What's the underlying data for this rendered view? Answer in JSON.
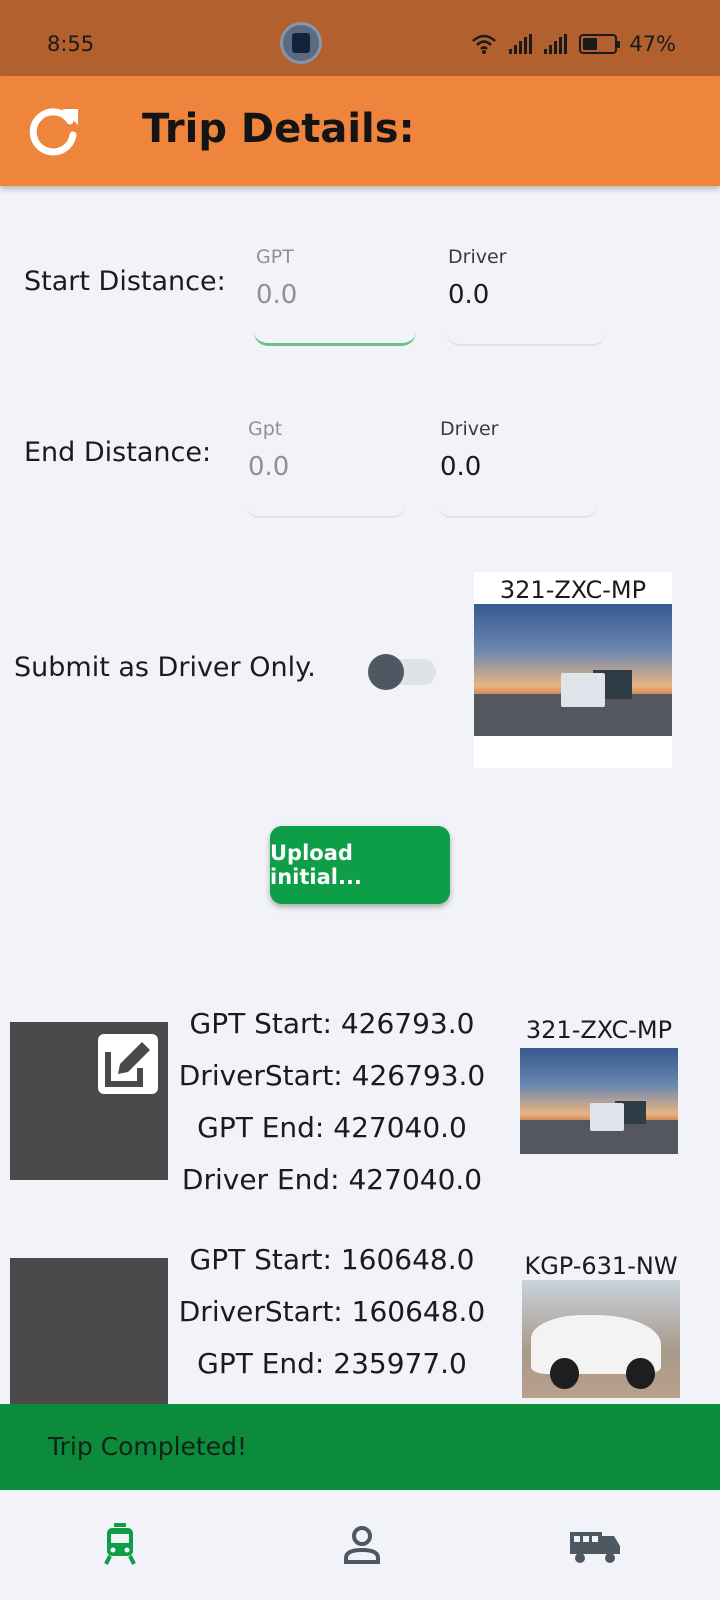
{
  "status_bar": {
    "time": "8:55",
    "battery": "47%",
    "battery_level": 0.47
  },
  "app_bar": {
    "title": "Trip Details:",
    "refresh_icon": "refresh-icon"
  },
  "start_distance": {
    "label": "Start Distance:",
    "gpt": {
      "label": "GPT",
      "value": "0.0"
    },
    "driver": {
      "label": "Driver",
      "value": "0.0"
    }
  },
  "end_distance": {
    "label": "End Distance:",
    "gpt": {
      "label": "Gpt",
      "value": "0.0"
    },
    "driver": {
      "label": "Driver",
      "value": "0.0"
    }
  },
  "driver_only": {
    "label": "Submit as Driver Only.",
    "enabled": false
  },
  "vehicle": {
    "plate": "321-ZXC-MP"
  },
  "upload_button": {
    "label": "Upload initial..."
  },
  "trips": [
    {
      "lines": [
        "GPT Start: 426793.0",
        "DriverStart: 426793.0",
        "GPT End: 427040.0",
        "Driver End: 427040.0"
      ],
      "plate": "321-ZXC-MP",
      "image": "truck-photo",
      "edit_icon": "edit-icon"
    },
    {
      "lines": [
        "GPT Start: 160648.0",
        "DriverStart: 160648.0",
        "GPT End: 235977.0"
      ],
      "plate": "KGP-631-NW",
      "image": "car-photo"
    }
  ],
  "snackbar": {
    "message": "Trip Completed!"
  },
  "bottom_nav": {
    "items": [
      {
        "icon": "train-icon",
        "active": true,
        "color": "#0d9e47"
      },
      {
        "icon": "person-icon",
        "active": false,
        "color": "#4e5862"
      },
      {
        "icon": "truck-icon",
        "active": false,
        "color": "#4e5862"
      }
    ]
  },
  "colors": {
    "app_bar": "#ef843d",
    "status_bar": "#b2602e",
    "accent_green": "#0d9e47",
    "snackbar": "#0c8b3b"
  }
}
